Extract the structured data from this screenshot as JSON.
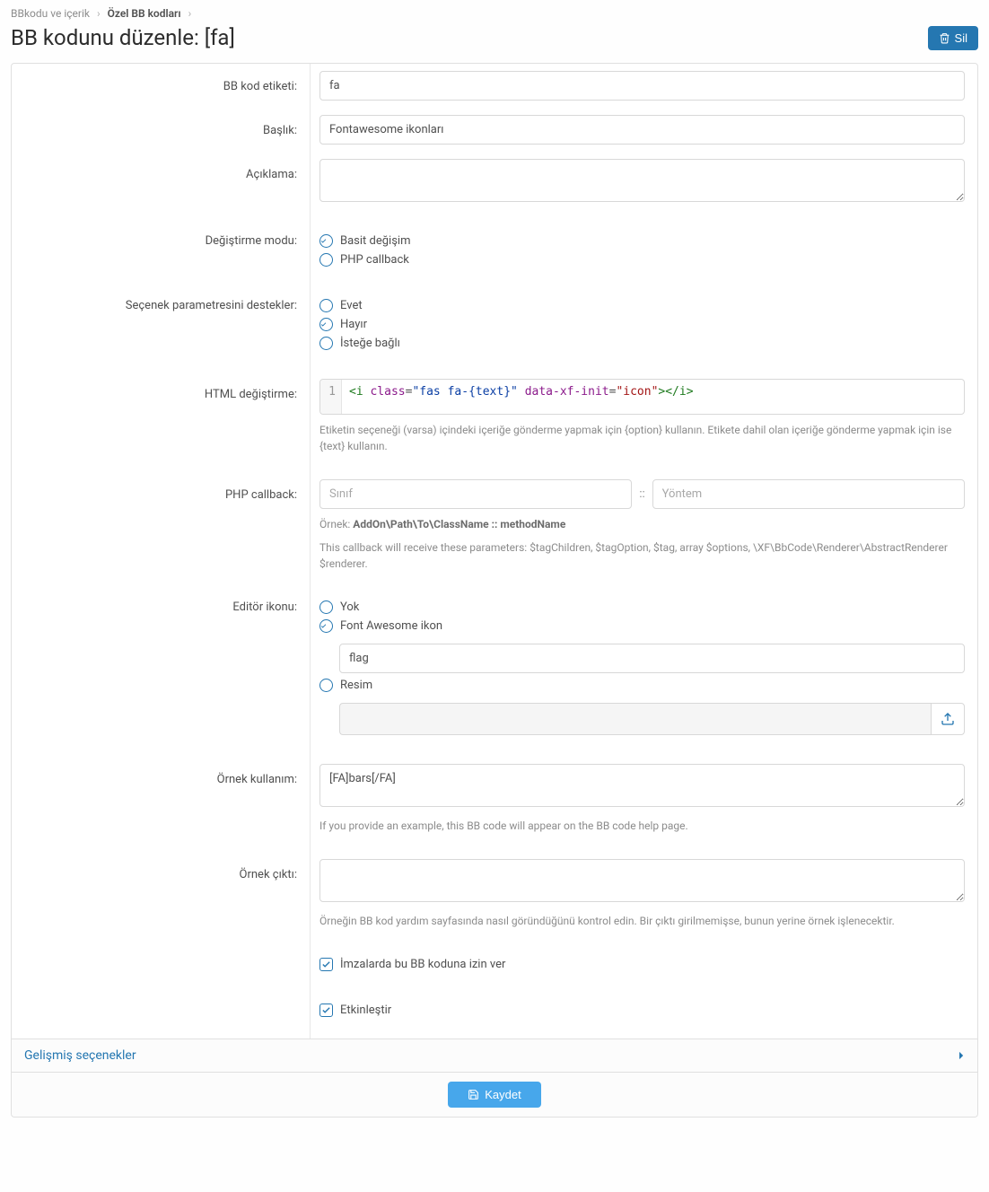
{
  "breadcrumb": {
    "item1": "BBkodu ve içerik",
    "item2": "Özel BB kodları"
  },
  "page_title": "BB kodunu düzenle: [fa]",
  "delete_label": "Sil",
  "fields": {
    "bb_tag": {
      "label": "BB kod etiketi:",
      "value": "fa"
    },
    "title": {
      "label": "Başlık:",
      "value": "Fontawesome ikonları"
    },
    "description": {
      "label": "Açıklama:"
    },
    "replace_mode": {
      "label": "Değiştirme modu:",
      "opt_simple": "Basit değişim",
      "opt_php": "PHP callback"
    },
    "supports_option": {
      "label": "Seçenek parametresini destekler:",
      "opt_yes": "Evet",
      "opt_no": "Hayır",
      "opt_optional": "İsteğe bağlı"
    },
    "html_replace": {
      "label": "HTML değiştirme:",
      "help": "Etiketin seçeneği (varsa) içindeki içeriğe gönderme yapmak için {option} kullanın. Etikete dahil olan içeriğe gönderme yapmak için ise {text} kullanın."
    },
    "php_callback": {
      "label": "PHP callback:",
      "class_placeholder": "Sınıf",
      "method_placeholder": "Yöntem",
      "example_prefix": "Örnek: ",
      "example_value": "AddOn\\Path\\To\\ClassName :: methodName",
      "help": "This callback will receive these parameters: $tagChildren, $tagOption, $tag, array $options, \\XF\\BbCode\\Renderer\\AbstractRenderer $renderer."
    },
    "editor_icon": {
      "label": "Editör ikonu:",
      "opt_none": "Yok",
      "opt_fa": "Font Awesome ikon",
      "fa_value": "flag",
      "opt_image": "Resim"
    },
    "example_usage": {
      "label": "Örnek kullanım:",
      "value": "[FA]bars[/FA]",
      "help": "If you provide an example, this BB code will appear on the BB code help page."
    },
    "example_output": {
      "label": "Örnek çıktı:",
      "help": "Örneğin BB kod yardım sayfasında nasıl göründüğünü kontrol edin. Bir çıktı girilmemişse, bunun yerine örnek işlenecektir."
    },
    "allow_sig": {
      "label": "İmzalarda bu BB koduna izin ver"
    },
    "enable": {
      "label": "Etkinleştir"
    }
  },
  "code": {
    "line_no": "1",
    "t1": "<i",
    "a1": "class",
    "v1": "\"fas fa-{text}\"",
    "a2": "data-xf-init",
    "v2": "\"icon\"",
    "t2": "></i>"
  },
  "adv_label": "Gelişmiş seçenekler",
  "save_label": "Kaydet"
}
